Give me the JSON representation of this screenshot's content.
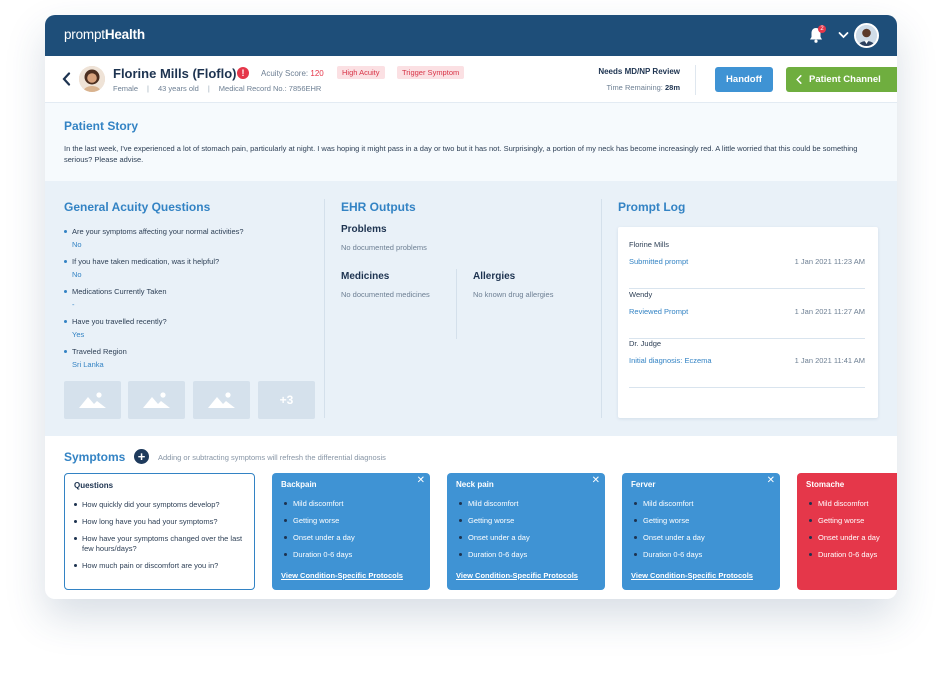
{
  "app": {
    "brand_light": "prompt",
    "brand_bold": "Health",
    "notification_count": "2"
  },
  "patient": {
    "name": "Florine Mills (Floflo)",
    "acuity_label": "Acuity Score:",
    "acuity_score": "120",
    "tag_high": "High Acuity",
    "tag_trigger": "Trigger Symptom",
    "gender": "Female",
    "age": "43 years old",
    "record": "Medical Record No.: 7856EHR",
    "review": "Needs MD/NP Review",
    "remaining_label": "Time Remaining:",
    "remaining_value": "28m",
    "handoff_label": "Handoff",
    "channel_label": "Patient Channel"
  },
  "story": {
    "title": "Patient Story",
    "text": "In the last week, I've experienced a lot of stomach pain, particularly at night. I was hoping it might pass in a day or two but it has not. Surprisingly, a portion of my neck has become increasingly red. A little worried that this could be something serious? Please advise."
  },
  "acuity_questions": {
    "title": "General Acuity Questions",
    "items": [
      {
        "q": "Are your symptoms affecting your normal activities?",
        "a": "No"
      },
      {
        "q": "If you have taken medication, was it helpful?",
        "a": "No"
      },
      {
        "q": "Medications Currently Taken",
        "a": "-"
      },
      {
        "q": "Have you travelled recently?",
        "a": "Yes"
      },
      {
        "q": "Traveled Region",
        "a": "Sri Lanka"
      }
    ],
    "more_images": "+3"
  },
  "ehr": {
    "title": "EHR Outputs",
    "problems_title": "Problems",
    "problems_value": "No documented problems",
    "medicines_title": "Medicines",
    "medicines_value": "No documented medicines",
    "allergies_title": "Allergies",
    "allergies_value": "No known drug allergies"
  },
  "prompt_log": {
    "title": "Prompt Log",
    "entries": [
      {
        "who": "Florine Mills",
        "action": "Submitted prompt",
        "time": "1 Jan 2021 11:23 AM"
      },
      {
        "who": "Wendy",
        "action": "Reviewed Prompt",
        "time": "1 Jan 2021 11:27 AM"
      },
      {
        "who": "Dr. Judge",
        "action": "Initial diagnosis: Eczema",
        "time": "1 Jan 2021 11:41 AM"
      }
    ]
  },
  "symptoms": {
    "title": "Symptoms",
    "hint": "Adding or subtracting symptoms will refresh the differential diagnosis",
    "questions_title": "Questions",
    "questions": [
      "How quickly did your symptoms develop?",
      "How long have you had your symptoms?",
      "How have your symptoms changed over the last few hours/days?",
      "How much pain or discomfort are you in?"
    ],
    "close_glyph": "✕",
    "link_label": "View Condition-Specific Protocols",
    "cards": [
      {
        "name": "Backpain",
        "items": [
          "Mild discomfort",
          "Getting worse",
          "Onset under a day",
          "Duration 0-6 days"
        ]
      },
      {
        "name": "Neck pain",
        "items": [
          "Mild discomfort",
          "Getting worse",
          "Onset under a day",
          "Duration 0-6 days"
        ]
      },
      {
        "name": "Ferver",
        "items": [
          "Mild discomfort",
          "Getting worse",
          "Onset under a day",
          "Duration 0-6 days"
        ]
      },
      {
        "name": "Stomache",
        "items": [
          "Mild discomfort",
          "Getting worse",
          "Onset under a day",
          "Duration 0-6 days"
        ]
      }
    ]
  },
  "colors": {
    "topbar": "#1e4e79",
    "accent_blue": "#3383c4",
    "card_blue": "#3f93d4",
    "alert_red": "#e5374a",
    "channel_green": "#6fae3f"
  }
}
